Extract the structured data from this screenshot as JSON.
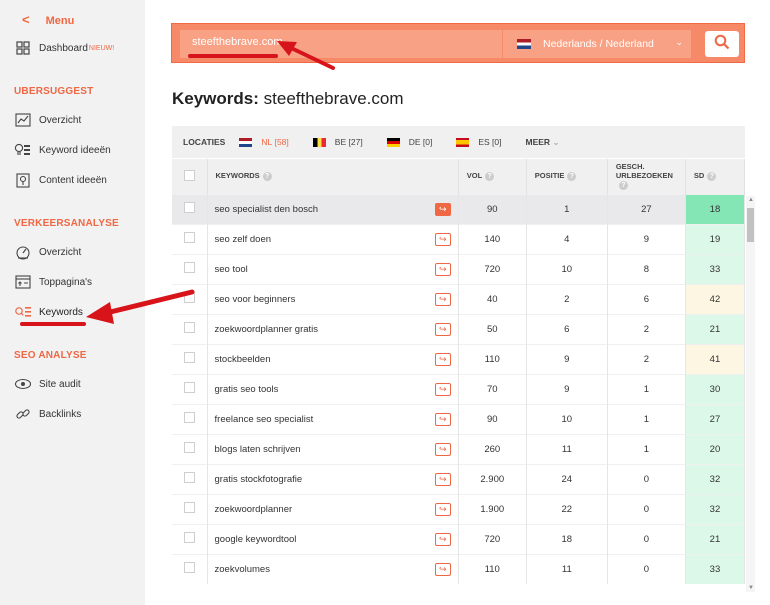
{
  "sidebar": {
    "menu_label": "Menu",
    "dashboard": {
      "label": "Dashboard",
      "badge": "NIEUW!"
    },
    "sections": [
      {
        "title": "UBERSUGGEST",
        "items": [
          "Overzicht",
          "Keyword ideeën",
          "Content ideeën"
        ]
      },
      {
        "title": "VERKEERSANALYSE",
        "items": [
          "Overzicht",
          "Toppagina's",
          "Keywords"
        ]
      },
      {
        "title": "SEO ANALYSE",
        "items": [
          "Site audit",
          "Backlinks"
        ]
      }
    ]
  },
  "search": {
    "value": "steefthebrave.com",
    "language": "Nederlands / Nederland"
  },
  "title": {
    "prefix": "Keywords:",
    "domain": "steefthebrave.com"
  },
  "locations": {
    "label": "LOCATIES",
    "items": [
      {
        "code": "NL",
        "count": "[58]"
      },
      {
        "code": "BE",
        "count": "[27]"
      },
      {
        "code": "DE",
        "count": "[0]"
      },
      {
        "code": "ES",
        "count": "[0]"
      }
    ],
    "more": "MEER"
  },
  "table": {
    "headers": {
      "keywords": "KEYWORDS",
      "vol": "VOL",
      "positie": "POSITIE",
      "gesch1": "GESCH.",
      "gesch2": "URLBEZOEKEN",
      "sd": "SD"
    },
    "rows": [
      {
        "keyword": "seo specialist den bosch",
        "vol": "90",
        "positie": "1",
        "gesch": "27",
        "sd": "18"
      },
      {
        "keyword": "seo zelf doen",
        "vol": "140",
        "positie": "4",
        "gesch": "9",
        "sd": "19"
      },
      {
        "keyword": "seo tool",
        "vol": "720",
        "positie": "10",
        "gesch": "8",
        "sd": "33"
      },
      {
        "keyword": "seo voor beginners",
        "vol": "40",
        "positie": "2",
        "gesch": "6",
        "sd": "42"
      },
      {
        "keyword": "zoekwoordplanner gratis",
        "vol": "50",
        "positie": "6",
        "gesch": "2",
        "sd": "21"
      },
      {
        "keyword": "stockbeelden",
        "vol": "110",
        "positie": "9",
        "gesch": "2",
        "sd": "41"
      },
      {
        "keyword": "gratis seo tools",
        "vol": "70",
        "positie": "9",
        "gesch": "1",
        "sd": "30"
      },
      {
        "keyword": "freelance seo specialist",
        "vol": "90",
        "positie": "10",
        "gesch": "1",
        "sd": "27"
      },
      {
        "keyword": "blogs laten schrijven",
        "vol": "260",
        "positie": "11",
        "gesch": "1",
        "sd": "20"
      },
      {
        "keyword": "gratis stockfotografie",
        "vol": "2.900",
        "positie": "24",
        "gesch": "0",
        "sd": "32"
      },
      {
        "keyword": "zoekwoordplanner",
        "vol": "1.900",
        "positie": "22",
        "gesch": "0",
        "sd": "32"
      },
      {
        "keyword": "google keywordtool",
        "vol": "720",
        "positie": "18",
        "gesch": "0",
        "sd": "21"
      },
      {
        "keyword": "zoekvolumes",
        "vol": "110",
        "positie": "11",
        "gesch": "0",
        "sd": "33"
      }
    ]
  },
  "colors": {
    "accent": "#f06744",
    "sd_easy": "#dcf8e9",
    "sd_medium": "#fdf6e3",
    "annotation": "#d8141b"
  }
}
